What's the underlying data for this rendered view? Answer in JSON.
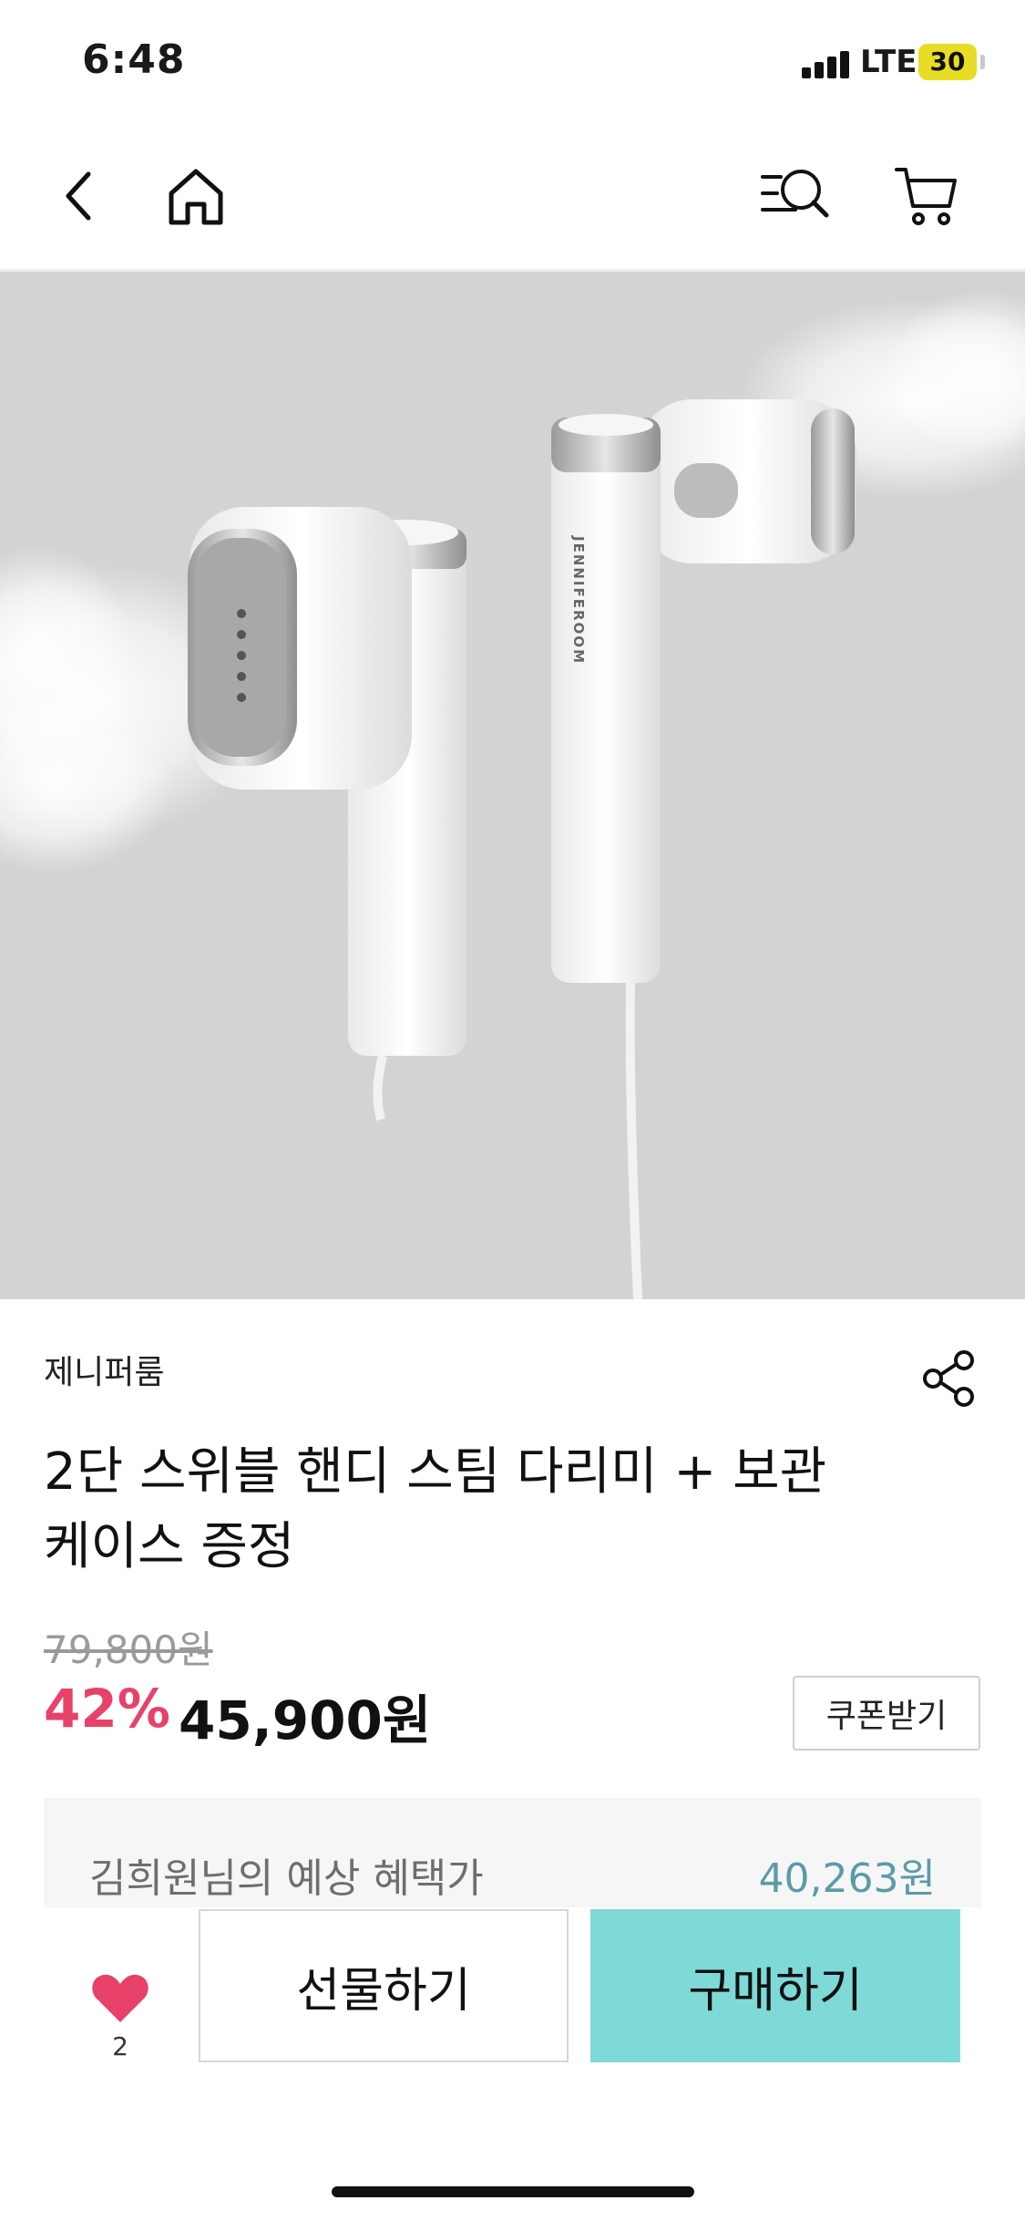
{
  "status": {
    "time": "6:48",
    "network": "LTE",
    "battery": "30"
  },
  "nav": {
    "icons": [
      "back-icon",
      "home-icon",
      "search-icon",
      "cart-icon"
    ]
  },
  "hero": {
    "brand_print": "JENNIFEROOM"
  },
  "product": {
    "brand": "제니퍼룸",
    "title_line1": "2단 스위블 핸디 스팀 다리미 + 보관",
    "title_line2": "케이스 증정",
    "original_price": "79,800원",
    "discount": "42%",
    "sale_price": "45,900원",
    "coupon_label": "쿠폰받기"
  },
  "benefit": {
    "label": "김희원님의 예상 혜택가",
    "value": "40,263원"
  },
  "bottom": {
    "wish_count": "2",
    "gift_label": "선물하기",
    "buy_label": "구매하기"
  },
  "colors": {
    "accent_pink": "#e8416a",
    "buy_button": "#7ed9d7",
    "benefit_value": "#5a9ba6",
    "battery": "#e8dc24"
  }
}
